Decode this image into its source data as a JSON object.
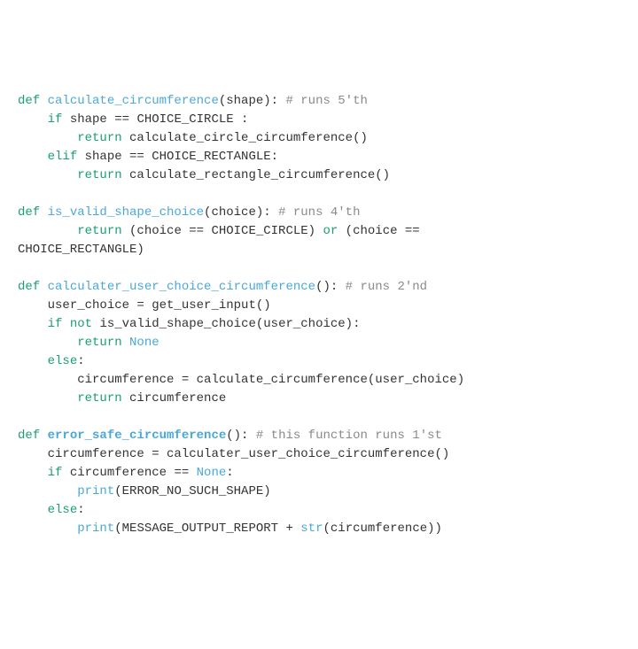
{
  "lines": [
    {
      "indent": 0,
      "segs": [
        {
          "t": "def ",
          "c": "kw"
        },
        {
          "t": "calculate_circumference",
          "c": "fn"
        },
        {
          "t": "(shape): "
        },
        {
          "t": "# runs 5'th",
          "c": "cm"
        }
      ]
    },
    {
      "indent": 1,
      "segs": [
        {
          "t": "if ",
          "c": "kw"
        },
        {
          "t": "shape == CHOICE_CIRCLE :"
        }
      ]
    },
    {
      "indent": 2,
      "segs": [
        {
          "t": "return ",
          "c": "kw"
        },
        {
          "t": "calculate_circle_circumference()"
        }
      ]
    },
    {
      "indent": 1,
      "segs": [
        {
          "t": "elif ",
          "c": "kw"
        },
        {
          "t": "shape == CHOICE_RECTANGLE:"
        }
      ]
    },
    {
      "indent": 2,
      "segs": [
        {
          "t": "return ",
          "c": "kw"
        },
        {
          "t": "calculate_rectangle_circumference()"
        }
      ]
    },
    {
      "indent": 0,
      "segs": [
        {
          "t": " "
        }
      ]
    },
    {
      "indent": 0,
      "segs": [
        {
          "t": "def ",
          "c": "kw"
        },
        {
          "t": "is_valid_shape_choice",
          "c": "fn"
        },
        {
          "t": "(choice): "
        },
        {
          "t": "# runs 4'th",
          "c": "cm"
        }
      ]
    },
    {
      "indent": 2,
      "segs": [
        {
          "t": "return ",
          "c": "kw"
        },
        {
          "t": "(choice == CHOICE_CIRCLE) "
        },
        {
          "t": "or",
          "c": "kw"
        },
        {
          "t": " (choice =="
        }
      ]
    },
    {
      "indent": 0,
      "segs": [
        {
          "t": "CHOICE_RECTANGLE)"
        }
      ]
    },
    {
      "indent": 0,
      "segs": [
        {
          "t": " "
        }
      ]
    },
    {
      "indent": 0,
      "segs": [
        {
          "t": "def ",
          "c": "kw"
        },
        {
          "t": "calculater_user_choice_circumference",
          "c": "fn"
        },
        {
          "t": "(): "
        },
        {
          "t": "# runs 2'nd",
          "c": "cm"
        }
      ]
    },
    {
      "indent": 1,
      "segs": [
        {
          "t": "user_choice = get_user_input()"
        }
      ]
    },
    {
      "indent": 1,
      "segs": [
        {
          "t": "if ",
          "c": "kw"
        },
        {
          "t": "not ",
          "c": "kw"
        },
        {
          "t": "is_valid_shape_choice(user_choice):"
        }
      ]
    },
    {
      "indent": 2,
      "segs": [
        {
          "t": "return ",
          "c": "kw"
        },
        {
          "t": "None",
          "c": "fn"
        }
      ]
    },
    {
      "indent": 1,
      "segs": [
        {
          "t": "else",
          "c": "kw"
        },
        {
          "t": ":"
        }
      ]
    },
    {
      "indent": 2,
      "segs": [
        {
          "t": "circumference = calculate_circumference(user_choice)"
        }
      ]
    },
    {
      "indent": 2,
      "segs": [
        {
          "t": "return ",
          "c": "kw"
        },
        {
          "t": "circumference"
        }
      ]
    },
    {
      "indent": 0,
      "segs": [
        {
          "t": " "
        }
      ]
    },
    {
      "indent": 0,
      "segs": [
        {
          "t": "def ",
          "c": "kw"
        },
        {
          "t": "error_safe_circumference",
          "c": "fn bold"
        },
        {
          "t": "(): "
        },
        {
          "t": "# this function runs 1'st",
          "c": "cm"
        }
      ]
    },
    {
      "indent": 1,
      "segs": [
        {
          "t": "circumference = calculater_user_choice_circumference()"
        }
      ]
    },
    {
      "indent": 1,
      "segs": [
        {
          "t": "if ",
          "c": "kw"
        },
        {
          "t": "circumference == "
        },
        {
          "t": "None",
          "c": "fn"
        },
        {
          "t": ":"
        }
      ]
    },
    {
      "indent": 2,
      "segs": [
        {
          "t": "print",
          "c": "fn"
        },
        {
          "t": "(ERROR_NO_SUCH_SHAPE)"
        }
      ]
    },
    {
      "indent": 1,
      "segs": [
        {
          "t": "else",
          "c": "kw"
        },
        {
          "t": ":"
        }
      ]
    },
    {
      "indent": 2,
      "segs": [
        {
          "t": "print",
          "c": "fn"
        },
        {
          "t": "(MESSAGE_OUTPUT_REPORT + "
        },
        {
          "t": "str",
          "c": "fn"
        },
        {
          "t": "(circumference))"
        }
      ]
    }
  ],
  "indentUnit": "    "
}
